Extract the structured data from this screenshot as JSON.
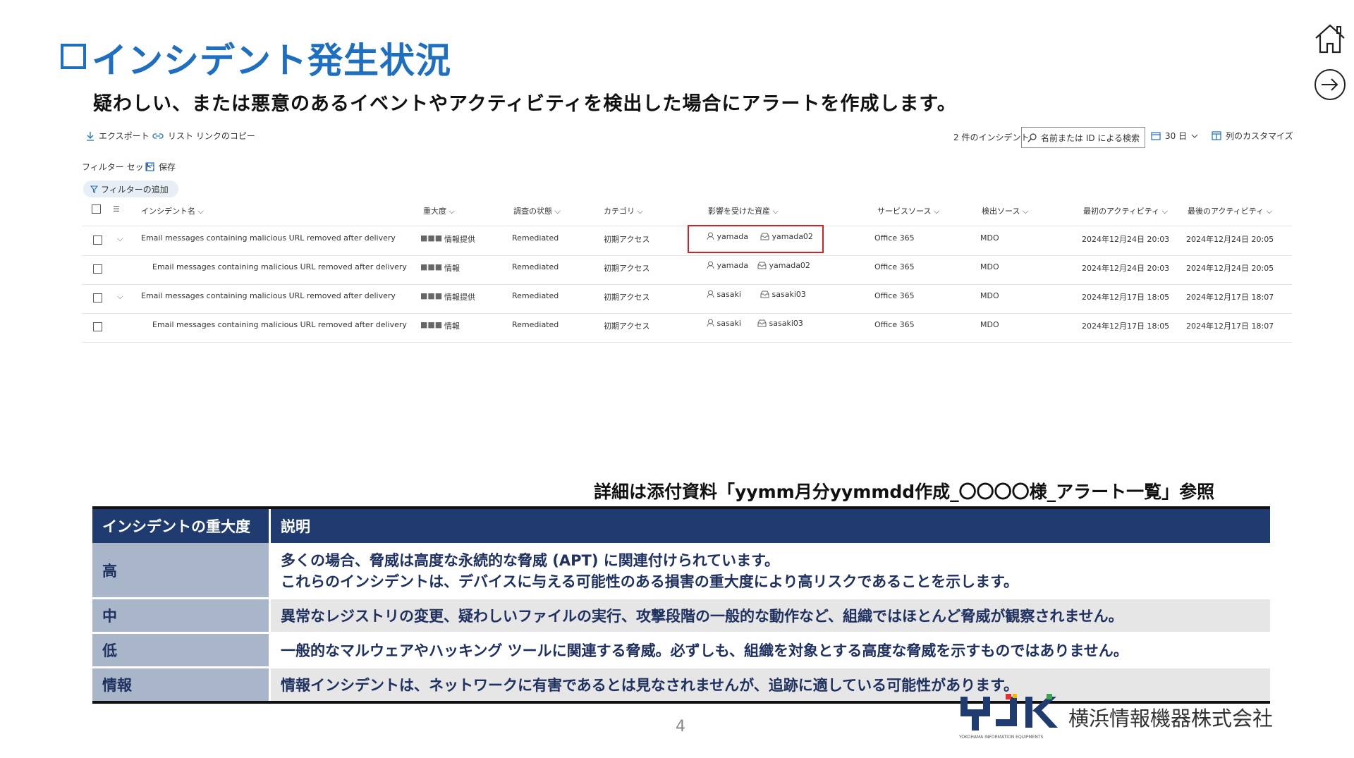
{
  "header": {
    "title": "インシデント発生状況",
    "subtitle": "疑わしい、または悪意のあるイベントやアクティビティを検出した場合にアラートを作成します。"
  },
  "nav": {
    "home_icon": "home-icon",
    "next_icon": "arrow-right-circle-icon"
  },
  "toolbar": {
    "export_label": "エクスポート",
    "copy_link_label": "リスト リンクのコピー",
    "incident_count": "2 件のインシデント",
    "search_placeholder": "名前または ID による検索",
    "range_label": "30 日",
    "customize_label": "列のカスタマイズ",
    "filter_set_label": "フィルター セット:",
    "save_label": "保存",
    "add_filter_label": "フィルターの追加"
  },
  "grid": {
    "columns": [
      "インシデント名",
      "重大度",
      "調査の状態",
      "カテゴリ",
      "影響を受けた資産",
      "サービスソース",
      "検出ソース",
      "最初のアクティビティ",
      "最後のアクティビティ"
    ],
    "rows": [
      {
        "name": "Email messages containing malicious URL removed after delivery",
        "severity_marks": "■■■",
        "severity": "情報提供",
        "status": "Remediated",
        "category": "初期アクセス",
        "user": "yamada",
        "mailbox": "yamada02",
        "service": "Office 365",
        "detection": "MDO",
        "first": "2024年12月24日 20:03",
        "last": "2024年12月24日 20:05"
      },
      {
        "name": "Email messages containing malicious URL removed after delivery",
        "severity_marks": "■■■",
        "severity": "情報",
        "status": "Remediated",
        "category": "初期アクセス",
        "user": "yamada",
        "mailbox": "yamada02",
        "service": "Office 365",
        "detection": "MDO",
        "first": "2024年12月24日 20:03",
        "last": "2024年12月24日 20:05"
      },
      {
        "name": "Email messages containing malicious URL removed after delivery",
        "severity_marks": "■■■",
        "severity": "情報提供",
        "status": "Remediated",
        "category": "初期アクセス",
        "user": "sasaki",
        "mailbox": "sasaki03",
        "service": "Office 365",
        "detection": "MDO",
        "first": "2024年12月17日 18:05",
        "last": "2024年12月17日 18:07"
      },
      {
        "name": "Email messages containing malicious URL removed after delivery",
        "severity_marks": "■■■",
        "severity": "情報",
        "status": "Remediated",
        "category": "初期アクセス",
        "user": "sasaki",
        "mailbox": "sasaki03",
        "service": "Office 365",
        "detection": "MDO",
        "first": "2024年12月17日 18:05",
        "last": "2024年12月17日 18:07"
      }
    ]
  },
  "reference_note": "詳細は添付資料「yymm月分yymmdd作成_〇〇〇〇様_アラート一覧」参照",
  "severity_table": {
    "headers": [
      "インシデントの重大度",
      "説明"
    ],
    "rows": [
      {
        "level": "高",
        "desc_line1": "多くの場合、脅威は高度な永続的な脅威 (APT) に関連付けられています。",
        "desc_line2": "これらのインシデントは、デバイスに与える可能性のある損害の重大度により高リスクであることを示します。"
      },
      {
        "level": "中",
        "desc_line1": "異常なレジストリの変更、疑わしいファイルの実行、攻撃段階の一般的な動作など、組織ではほとんど脅威が観察されません。"
      },
      {
        "level": "低",
        "desc_line1": "一般的なマルウェアやハッキング ツールに関連する脅威。必ずしも、組織を対象とする高度な脅威を示すものではありません。"
      },
      {
        "level": "情報",
        "desc_line1": "情報インシデントは、ネットワークに有害であるとは見なされませんが、追跡に適している可能性があります。"
      }
    ]
  },
  "footer": {
    "page_number": "4",
    "company_name": "横浜情報機器株式会社",
    "logo_letters": "YJK",
    "logo_subtext": "YOKOHAMA INFORMATION EQUIPMENTS",
    "logo_colors": [
      "#1f3b70",
      "#e03030",
      "#f2b800",
      "#3fa34d"
    ]
  }
}
